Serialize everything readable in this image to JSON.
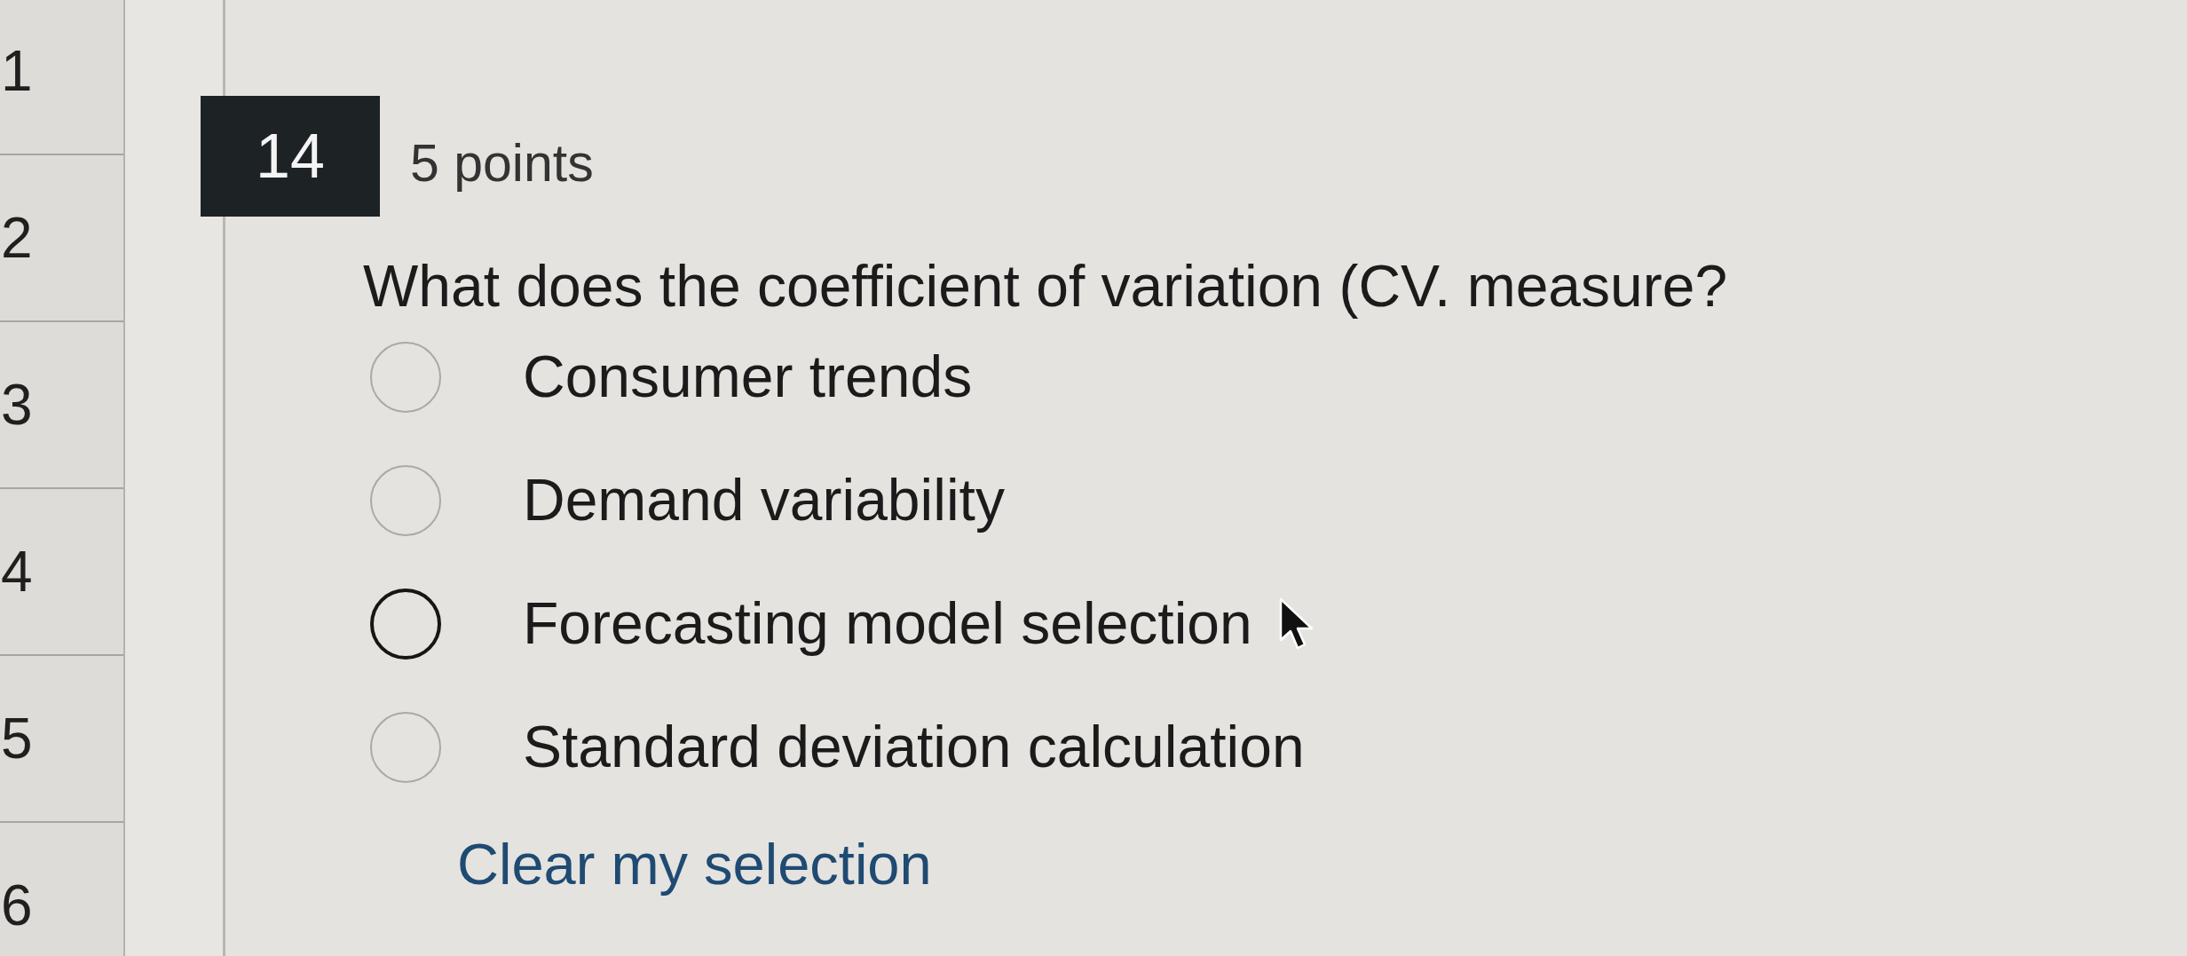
{
  "sidebar": {
    "items": [
      {
        "label": "1"
      },
      {
        "label": "2"
      },
      {
        "label": "3"
      },
      {
        "label": "4"
      },
      {
        "label": "5"
      },
      {
        "label": "6"
      }
    ]
  },
  "question": {
    "number": "14",
    "points": "5 points",
    "text": "What does the coefficient of variation (CV. measure?",
    "options": [
      {
        "label": "Consumer trends",
        "selected": false,
        "hovered": false
      },
      {
        "label": "Demand variability",
        "selected": false,
        "hovered": false
      },
      {
        "label": "Forecasting model selection",
        "selected": false,
        "hovered": true
      },
      {
        "label": "Standard deviation calculation",
        "selected": false,
        "hovered": false
      }
    ],
    "clear_link": "Clear my selection"
  }
}
